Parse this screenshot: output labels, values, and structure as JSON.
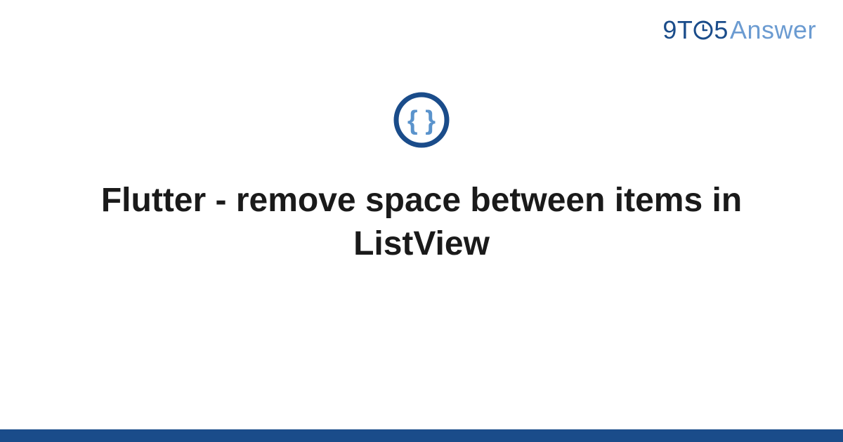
{
  "logo": {
    "nine": "9",
    "t": "T",
    "five": "5",
    "answer": "Answer"
  },
  "title": "Flutter - remove space between items in ListView",
  "colors": {
    "brand_dark": "#1a4c8a",
    "brand_light": "#6b9bd1"
  }
}
